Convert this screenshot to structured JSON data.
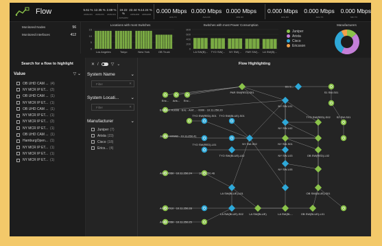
{
  "app": {
    "title": "Flow"
  },
  "kpis": [
    {
      "value": "5.61 %",
      "label": "AMSCFN"
    },
    {
      "value": "12.35 %",
      "label": "AMSCFN"
    },
    {
      "value": "2.89 %",
      "label": "AMSCFN"
    },
    {
      "value": "19.22 %",
      "label": "AMSHDM"
    },
    {
      "value": "22.44 %",
      "label": "AMSHDM"
    },
    {
      "value": "14.24 %",
      "label": "AMSHDM"
    }
  ],
  "throughput": [
    {
      "values": [
        "0.000 Mbps",
        "0.000 Mbps",
        "0.000 Mbps"
      ],
      "labels": [
        "AVG TX",
        "AVG RX",
        "MIN RX"
      ]
    },
    {
      "values": [
        "0.000 Mbps",
        "0.000 Mbps",
        "0.000 Mbps"
      ],
      "labels": [
        "AVG RX",
        "AVG TX",
        "MIN TX"
      ]
    }
  ],
  "stats": [
    {
      "label": "Monitored Nodes",
      "value": "56"
    },
    {
      "label": "Monitored interfaces",
      "value": "412"
    }
  ],
  "switches_chart": {
    "title": "Locations with most Switches"
  },
  "power_chart": {
    "title": "Switches with most Power Consumption"
  },
  "manufacturers": {
    "title": "Manufacturers",
    "legend": [
      {
        "name": "Juniper",
        "color": "#8bc34a"
      },
      {
        "name": "Arista",
        "color": "#c47fd8"
      },
      {
        "name": "Cisco",
        "color": "#2ea8d8"
      },
      {
        "name": "Ericsson",
        "color": "#f0a04b"
      }
    ]
  },
  "chart_data": [
    {
      "type": "bar",
      "title": "Locations with most Switches",
      "categories": [
        "Los Angeles",
        "Tokyo",
        "New York",
        "OB Truck"
      ],
      "values": [
        14,
        14,
        14,
        11
      ],
      "ylim": [
        0,
        15
      ],
      "yticks": [
        "15",
        "10",
        "5",
        "0"
      ]
    },
    {
      "type": "bar",
      "title": "Switches with most Power Consumption",
      "categories": [
        "LA SW(B)...",
        "TYO SW(...",
        "NY SW(...",
        "PAR SW(...",
        "LA SW(B)..."
      ],
      "values": [
        450,
        440,
        430,
        420,
        410
      ],
      "ylim": [
        0,
        800
      ],
      "yticks": [
        "800",
        "600",
        "400",
        "200",
        "0"
      ]
    },
    {
      "type": "pie",
      "title": "Manufacturers",
      "categories": [
        "Juniper",
        "Arista",
        "Cisco",
        "Ericsson"
      ],
      "values": [
        7,
        23,
        18,
        4
      ]
    }
  ],
  "search_panel": {
    "title": "Search for a flow to highlight",
    "value_label": "Value",
    "items": [
      {
        "label": "OB UHD CAM ...",
        "count": "(4)"
      },
      {
        "label": "NY MCR IP ET...",
        "count": "(2)"
      },
      {
        "label": "OB UHD CAM ...",
        "count": "(1)"
      },
      {
        "label": "NY MCR IP ET...",
        "count": "(1)"
      },
      {
        "label": "OB UHD CAM ...",
        "count": "(1)"
      },
      {
        "label": "NY MCR IP ET...",
        "count": "(1)"
      },
      {
        "label": "NY MCR IP ET...",
        "count": "(2)"
      },
      {
        "label": "NY MCR IP ET...",
        "count": "(1)"
      },
      {
        "label": "OB UHD CAM ...",
        "count": "(1)"
      },
      {
        "label": "HamburgOpen...",
        "count": "(1)"
      },
      {
        "label": "NY MCR IP ET...",
        "count": "(1)"
      },
      {
        "label": "NY MCR IP ET...",
        "count": "(1)"
      },
      {
        "label": "NY MCR IP ET...",
        "count": "(1)"
      }
    ]
  },
  "filters": {
    "system_name": {
      "label": "System Name",
      "placeholder": "Filter"
    },
    "system_location": {
      "label": "System Locati...",
      "placeholder": "Filter"
    },
    "manufacturer": {
      "label": "Manufacturer",
      "items": [
        {
          "label": "Juniper",
          "count": "(7)"
        },
        {
          "label": "Arista",
          "count": "(23)"
        },
        {
          "label": "Cisco",
          "count": "(18)"
        },
        {
          "label": "Erics...",
          "count": "(4)"
        }
      ]
    }
  },
  "flow_panel": {
    "title": "Flow Highlighting",
    "node_labels": [
      "Eric...",
      "Aris...",
      "Enc...",
      "PAR SW(RED)-S01",
      "SS S...",
      "S1 SW-S01",
      "Ericsson R3006 · Eric · Arnf... · 0000 · 10.11.250.20",
      "NY SW-L01",
      "TYO SW(RED)-S01",
      "TYO SW(BLUE)-S01",
      "NY SW-L02",
      "NY SW-S02",
      "NY SW-S01",
      "TYO SW(RED)-S02",
      "S2 SW-S01",
      "Juniper MX960 · 10.11.250.41",
      "TYO SW(BLUE)-L02",
      "TYO SW(RED)-L01",
      "NY SW-L03",
      "NY SW-L05",
      "OB SW(RED)-L02",
      "Arista 7050 · 10.11.250.24",
      "10.11.250.46",
      "LA SW(BLUE)-L01",
      "OB SW(BLUE)-S01",
      "Arista 7010 · 10.11.250.28",
      "LA SW(BLUE)-S02",
      "LA SW(BLUE)",
      "LA SW(BL...",
      "OB SW(BLUE)-L01",
      "Arista 7050 · 10.11.250.25"
    ]
  }
}
